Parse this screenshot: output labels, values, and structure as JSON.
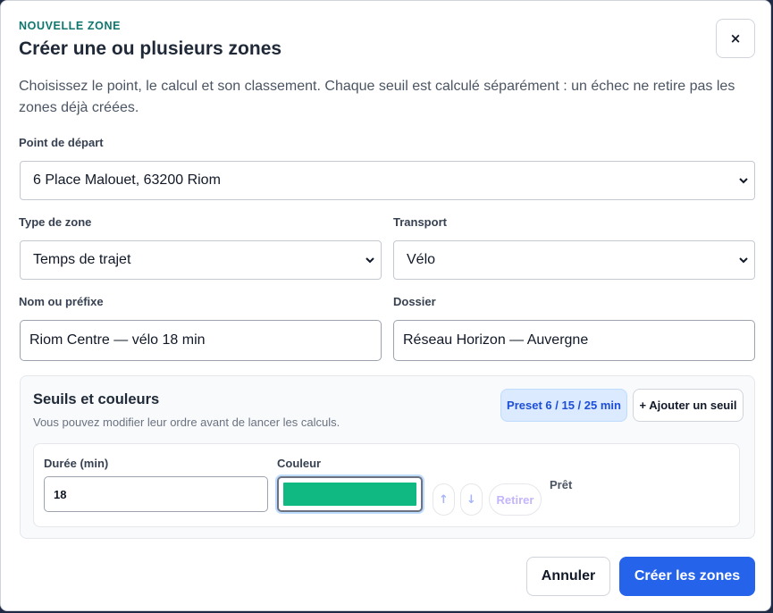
{
  "modal": {
    "eyebrow": "NOUVELLE ZONE",
    "title": "Créer une ou plusieurs zones",
    "close_label": "×",
    "intro": "Choisissez le point, le calcul et son classement. Chaque seuil est calculé séparément : un échec ne retire pas les zones déjà créées."
  },
  "form": {
    "start_point": {
      "label": "Point de départ",
      "value": "6 Place Malouet, 63200 Riom"
    },
    "zone_type": {
      "label": "Type de zone",
      "value": "Temps de trajet"
    },
    "transport": {
      "label": "Transport",
      "value": "Vélo"
    },
    "name": {
      "label": "Nom ou préfixe",
      "value": "Riom Centre — vélo 18 min"
    },
    "folder": {
      "label": "Dossier",
      "value": "Réseau Horizon — Auvergne"
    }
  },
  "thresholds": {
    "title": "Seuils et couleurs",
    "subtitle": "Vous pouvez modifier leur ordre avant de lancer les calculs.",
    "preset_label": "Preset 6 / 15 / 25 min",
    "add_label": "+ Ajouter un seuil",
    "rows": [
      {
        "duration_label": "Durée (min)",
        "duration_value": "18",
        "color_label": "Couleur",
        "color_value": "#10b981",
        "up_label": "↑",
        "down_label": "↓",
        "remove_label": "Retirer",
        "status": "Prêt"
      }
    ]
  },
  "footer": {
    "cancel_label": "Annuler",
    "create_label": "Créer les zones"
  },
  "colors": {
    "accent": "#2563eb",
    "eyebrow": "#0f766e",
    "preset_bg": "#dbeafe"
  }
}
